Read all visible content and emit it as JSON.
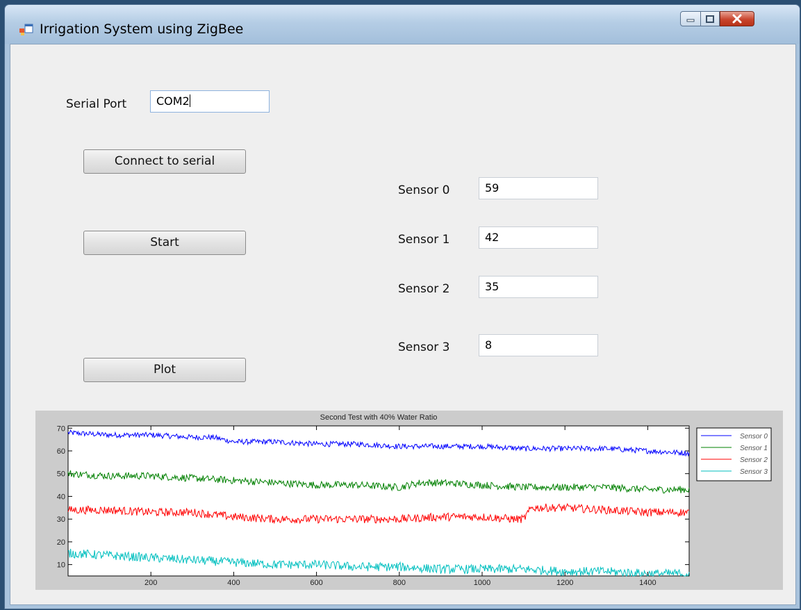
{
  "window": {
    "title": "Irrigation System using ZigBee"
  },
  "serial": {
    "label": "Serial Port",
    "value": "COM2"
  },
  "buttons": {
    "connect": "Connect to serial",
    "start": "Start",
    "plot": "Plot"
  },
  "sensors": [
    {
      "label": "Sensor 0",
      "value": "59"
    },
    {
      "label": "Sensor 1",
      "value": "42"
    },
    {
      "label": "Sensor 2",
      "value": "35"
    },
    {
      "label": "Sensor 3",
      "value": "8"
    }
  ],
  "colors": {
    "sensor0": "#0000ff",
    "sensor1": "#008000",
    "sensor2": "#ff0000",
    "sensor3": "#00bfbf"
  },
  "chart_data": {
    "type": "line",
    "title": "Second Test with 40% Water Ratio",
    "xlabel": "",
    "ylabel": "",
    "xlim": [
      0,
      1500
    ],
    "ylim": [
      5,
      71
    ],
    "xticks": [
      200,
      400,
      600,
      800,
      1000,
      1200,
      1400
    ],
    "yticks": [
      10,
      20,
      30,
      40,
      50,
      60,
      70
    ],
    "grid": false,
    "legend_position": "right",
    "noise_amplitude": [
      1.2,
      1.6,
      1.8,
      2.0
    ],
    "series": [
      {
        "name": "Sensor 0",
        "color": "#0000ff",
        "x": [
          0,
          100,
          200,
          300,
          350,
          400,
          500,
          600,
          700,
          800,
          900,
          1000,
          1100,
          1200,
          1300,
          1400,
          1500
        ],
        "y": [
          68,
          67,
          67,
          66,
          66,
          64,
          64,
          63,
          63,
          62,
          62,
          62,
          61,
          61,
          61,
          60,
          59
        ]
      },
      {
        "name": "Sensor 1",
        "color": "#008000",
        "x": [
          0,
          100,
          200,
          300,
          400,
          500,
          600,
          700,
          800,
          850,
          900,
          1000,
          1100,
          1200,
          1300,
          1400,
          1500
        ],
        "y": [
          50,
          49,
          49,
          48,
          47,
          46,
          45,
          45,
          44,
          46,
          46,
          45,
          44,
          44,
          44,
          43,
          43
        ]
      },
      {
        "name": "Sensor 2",
        "color": "#ff0000",
        "x": [
          0,
          100,
          200,
          300,
          400,
          500,
          600,
          700,
          800,
          900,
          1000,
          1080,
          1100,
          1120,
          1200,
          1300,
          1400,
          1500
        ],
        "y": [
          34,
          34,
          33,
          33,
          31,
          30,
          30,
          30,
          30,
          31,
          31,
          30,
          30,
          35,
          35,
          34,
          33,
          33
        ]
      },
      {
        "name": "Sensor 3",
        "color": "#00bfbf",
        "x": [
          0,
          100,
          200,
          300,
          400,
          500,
          600,
          700,
          800,
          900,
          1000,
          1100,
          1200,
          1300,
          1400,
          1500
        ],
        "y": [
          15,
          14,
          13,
          12,
          11,
          10,
          10,
          9,
          9,
          8,
          8,
          8,
          7,
          7,
          6,
          6
        ]
      }
    ]
  }
}
